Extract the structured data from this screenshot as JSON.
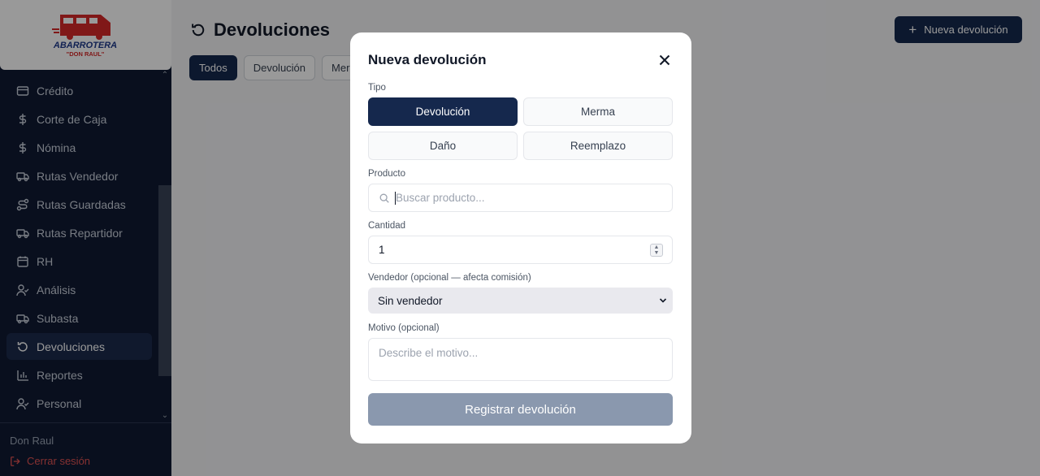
{
  "brand": {
    "logo_line1": "ABARROTERA",
    "logo_line2": "\"DON RAUL\""
  },
  "sidebar": {
    "items": [
      {
        "label": "Crédito",
        "icon": "credit-card-icon"
      },
      {
        "label": "Corte de Caja",
        "icon": "dollar-icon"
      },
      {
        "label": "Nómina",
        "icon": "dollar-icon"
      },
      {
        "label": "Rutas Vendedor",
        "icon": "truck-icon"
      },
      {
        "label": "Rutas Guardadas",
        "icon": "route-icon"
      },
      {
        "label": "Rutas Repartidor",
        "icon": "truck-icon"
      },
      {
        "label": "RH",
        "icon": "calendar-icon"
      },
      {
        "label": "Análisis",
        "icon": "user-check-icon"
      },
      {
        "label": "Subasta",
        "icon": "truck-icon"
      },
      {
        "label": "Devoluciones",
        "icon": "rotate-ccw-icon",
        "active": true
      },
      {
        "label": "Reportes",
        "icon": "bar-chart-icon"
      },
      {
        "label": "Personal",
        "icon": "user-check-icon"
      }
    ],
    "user": "Don Raul",
    "logout": "Cerrar sesión"
  },
  "page": {
    "title": "Devoluciones",
    "new_button": "Nueva devolución",
    "tabs": [
      "Todos",
      "Devolución",
      "Mer"
    ]
  },
  "modal": {
    "title": "Nueva devolución",
    "tipo_label": "Tipo",
    "types": [
      "Devolución",
      "Merma",
      "Daño",
      "Reemplazo"
    ],
    "producto_label": "Producto",
    "producto_placeholder": "Buscar producto...",
    "cantidad_label": "Cantidad",
    "cantidad_value": "1",
    "vendedor_label": "Vendedor (opcional — afecta comisión)",
    "vendedor_value": "Sin vendedor",
    "motivo_label": "Motivo (opcional)",
    "motivo_placeholder": "Describe el motivo...",
    "submit": "Registrar devolución"
  },
  "colors": {
    "primary": "#15284d",
    "sidebar": "#0f1a33",
    "logout": "#e05252",
    "logo_red": "#d62828",
    "logo_blue": "#1f3a8a"
  }
}
